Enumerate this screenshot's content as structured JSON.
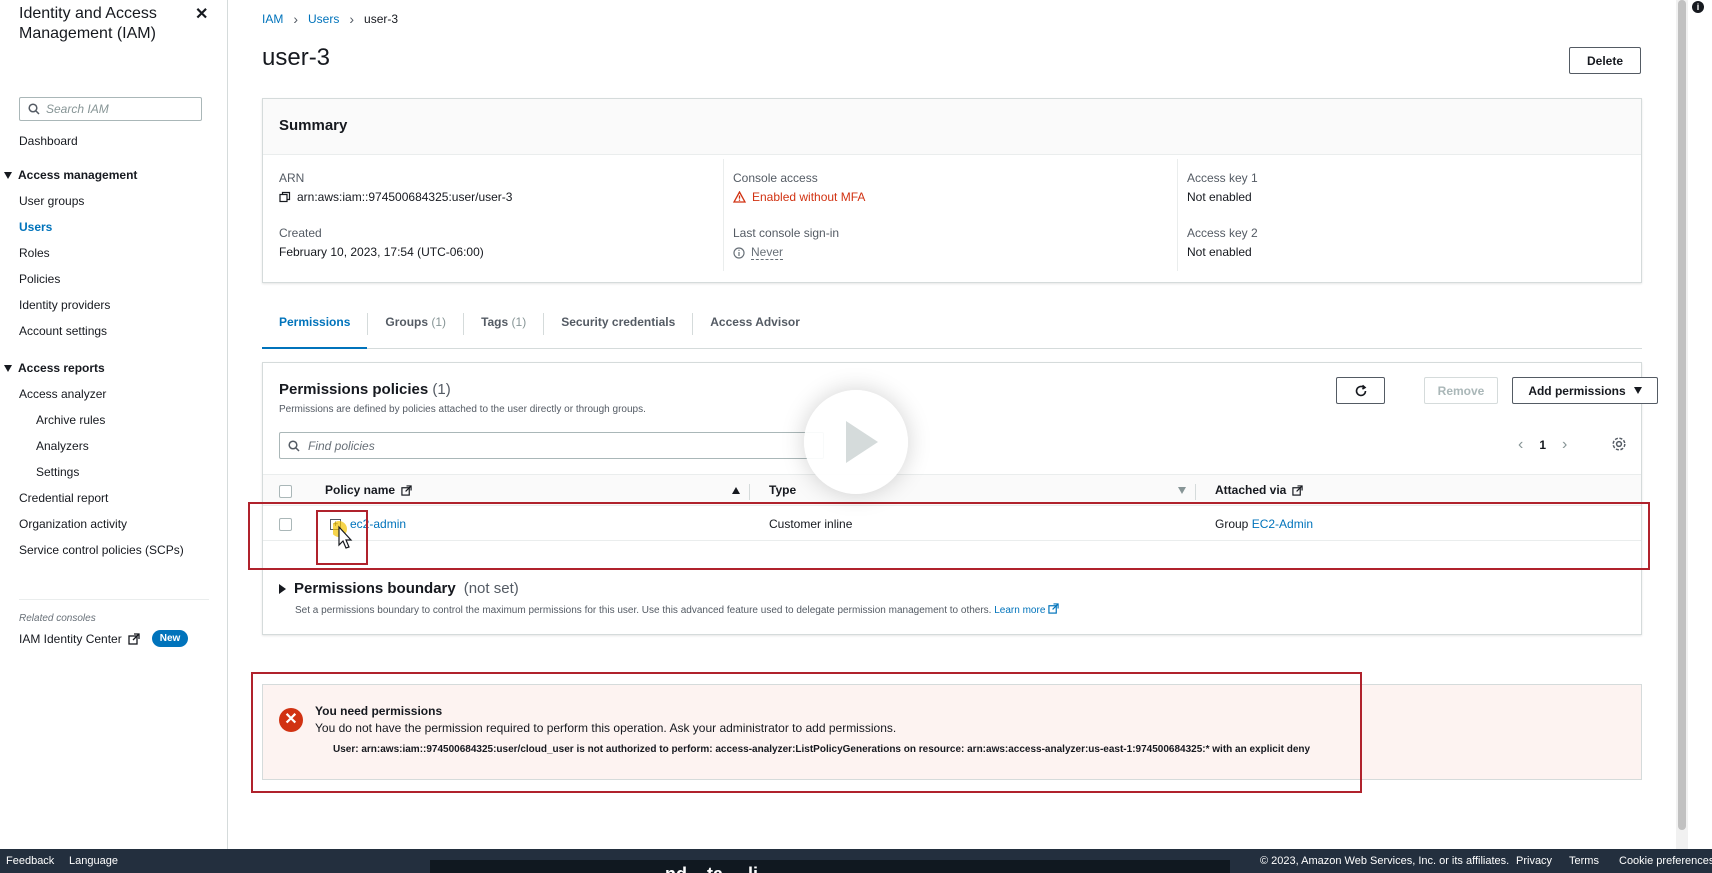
{
  "sidebar": {
    "title": "Identity and Access Management (IAM)",
    "search_placeholder": "Search IAM",
    "dashboard": "Dashboard",
    "sections": [
      {
        "label": "Access management"
      },
      {
        "label": "Access reports"
      }
    ],
    "access_management_items": [
      "User groups",
      "Users",
      "Roles",
      "Policies",
      "Identity providers",
      "Account settings"
    ],
    "access_reports_items": [
      "Access analyzer",
      "Archive rules",
      "Analyzers",
      "Settings",
      "Credential report",
      "Organization activity",
      "Service control policies (SCPs)"
    ],
    "related_consoles": "Related consoles",
    "identity_center": "IAM Identity Center",
    "new_badge": "New"
  },
  "breadcrumb": [
    "IAM",
    "Users",
    "user-3"
  ],
  "page_title": "user-3",
  "delete_label": "Delete",
  "summary": {
    "heading": "Summary",
    "arn_label": "ARN",
    "arn_value": "arn:aws:iam::974500684325:user/user-3",
    "created_label": "Created",
    "created_value": "February 10, 2023, 17:54 (UTC-06:00)",
    "console_access_label": "Console access",
    "console_access_value": "Enabled without MFA",
    "last_signin_label": "Last console sign-in",
    "last_signin_value": "Never",
    "key1_label": "Access key 1",
    "key1_value": "Not enabled",
    "key2_label": "Access key 2",
    "key2_value": "Not enabled"
  },
  "tabs": [
    {
      "label": "Permissions",
      "count": ""
    },
    {
      "label": "Groups",
      "count": "(1)"
    },
    {
      "label": "Tags",
      "count": "(1)"
    },
    {
      "label": "Security credentials",
      "count": ""
    },
    {
      "label": "Access Advisor",
      "count": ""
    }
  ],
  "permissions": {
    "title": "Permissions policies",
    "count": "(1)",
    "description": "Permissions are defined by policies attached to the user directly or through groups.",
    "remove_label": "Remove",
    "add_label": "Add permissions",
    "filter_placeholder": "Find policies",
    "page": "1",
    "columns": [
      "Policy name",
      "Type",
      "Attached via"
    ],
    "rows": [
      {
        "name": "ec2-admin",
        "type": "Customer inline",
        "via_prefix": "Group",
        "via_link": "EC2-Admin"
      }
    ]
  },
  "boundary": {
    "title": "Permissions boundary",
    "status": "(not set)",
    "description": "Set a permissions boundary to control the maximum permissions for this user. Use this advanced feature used to delegate permission management to others.",
    "learn_more": "Learn more"
  },
  "error": {
    "title": "You need permissions",
    "message": "You do not have the permission required to perform this operation. Ask your administrator to add permissions.",
    "detail": "User: arn:aws:iam::974500684325:user/cloud_user is not authorized to perform: access-analyzer:ListPolicyGenerations on resource: arn:aws:access-analyzer:us-east-1:974500684325:* with an explicit deny"
  },
  "footer": {
    "feedback": "Feedback",
    "language": "Language",
    "copyright": "© 2023, Amazon Web Services, Inc. or its affiliates.",
    "privacy": "Privacy",
    "terms": "Terms",
    "cookies": "Cookie preferences"
  },
  "caption": "...nd ...ta ... li... ...",
  "colors": {
    "link": "#0073bb",
    "error": "#d13212",
    "highlight": "#b0222c",
    "footer": "#232f3e"
  },
  "icons": [
    "close-icon",
    "search-icon",
    "copy-icon",
    "warning-icon",
    "info-icon",
    "refresh-icon",
    "external-link-icon",
    "settings-gear-icon",
    "error-icon",
    "play-icon",
    "cursor-icon"
  ]
}
